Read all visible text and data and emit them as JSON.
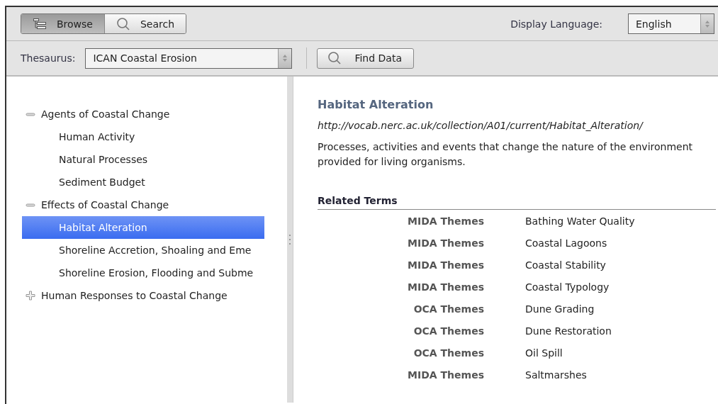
{
  "toolbar": {
    "modes": [
      {
        "label": "Browse",
        "selected": true
      },
      {
        "label": "Search",
        "selected": false
      }
    ],
    "language_label": "Display Language:",
    "language": "English"
  },
  "filter_bar": {
    "thesaurus_label": "Thesaurus:",
    "thesaurus": "ICAN Coastal Erosion",
    "find_button": "Find Data"
  },
  "tree": [
    {
      "label": "Agents of Coastal Change",
      "expanded": true,
      "children": [
        {
          "label": "Human Activity",
          "selected": false
        },
        {
          "label": "Natural Processes",
          "selected": false
        },
        {
          "label": "Sediment Budget",
          "selected": false
        }
      ]
    },
    {
      "label": "Effects of Coastal Change",
      "expanded": true,
      "children": [
        {
          "label": "Habitat Alteration",
          "selected": true
        },
        {
          "label": "Shoreline Accretion, Shoaling and Eme",
          "selected": false
        },
        {
          "label": "Shoreline Erosion, Flooding and Subme",
          "selected": false
        }
      ]
    },
    {
      "label": "Human Responses to Coastal Change",
      "expanded": false
    }
  ],
  "detail": {
    "title": "Habitat Alteration",
    "uri": "http://vocab.nerc.ac.uk/collection/A01/current/Habitat_Alteration/",
    "definition": "Processes, activities and events that change the nature of the environment provided for living organisms.",
    "related_heading": "Related Terms",
    "related": [
      {
        "scheme": "MIDA Themes",
        "term": "Bathing Water Quality"
      },
      {
        "scheme": "MIDA Themes",
        "term": "Coastal Lagoons"
      },
      {
        "scheme": "MIDA Themes",
        "term": "Coastal Stability"
      },
      {
        "scheme": "MIDA Themes",
        "term": "Coastal Typology"
      },
      {
        "scheme": "OCA Themes",
        "term": "Dune Grading"
      },
      {
        "scheme": "OCA Themes",
        "term": "Dune Restoration"
      },
      {
        "scheme": "OCA Themes",
        "term": "Oil Spill"
      },
      {
        "scheme": "MIDA Themes",
        "term": "Saltmarshes"
      }
    ]
  }
}
